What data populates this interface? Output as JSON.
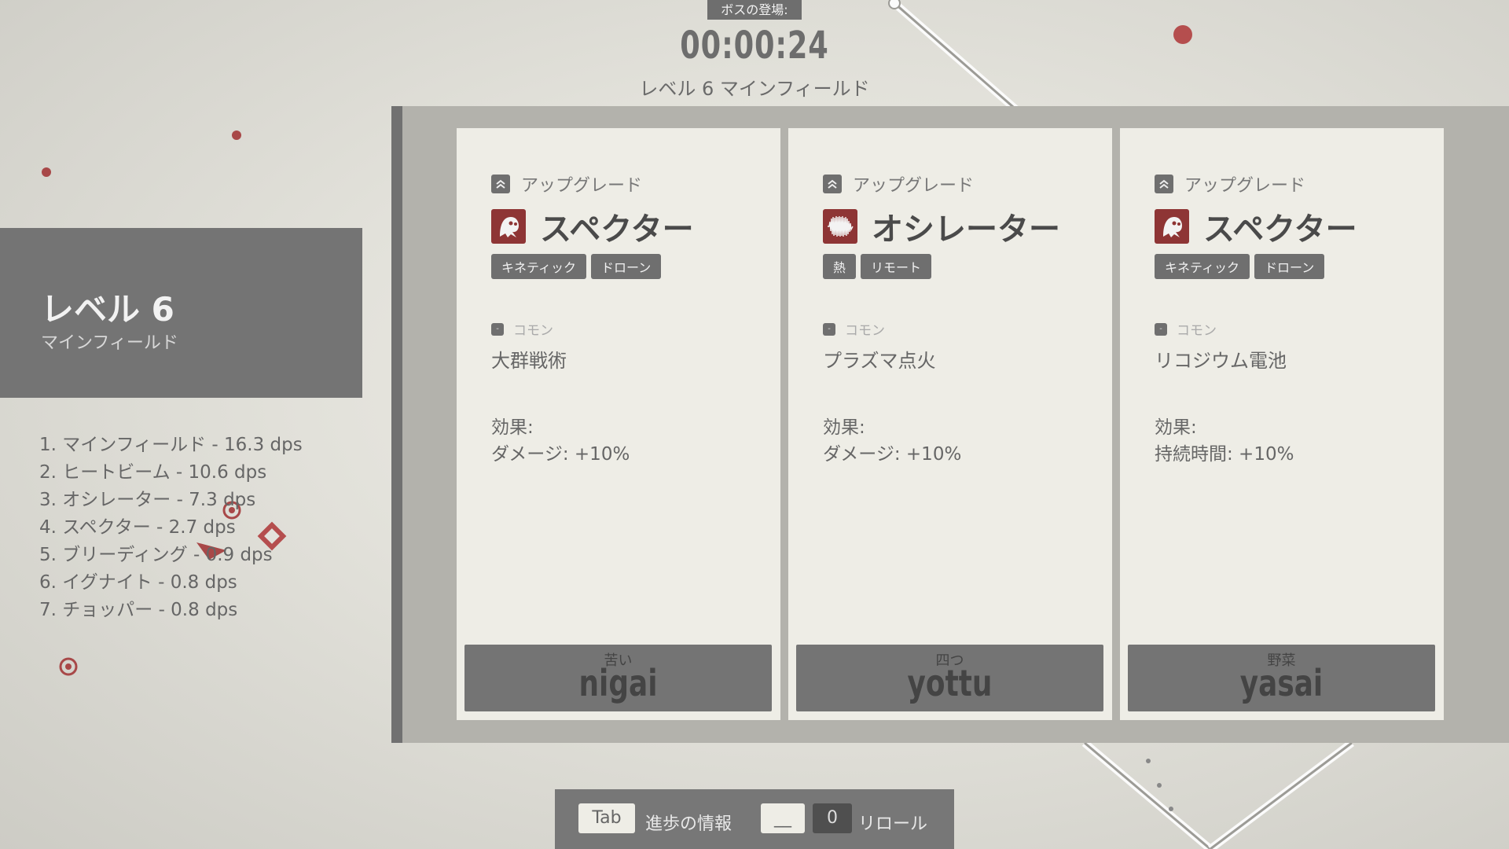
{
  "header": {
    "boss_label": "ボスの登場:",
    "timer": "00:00:24",
    "subtitle": "レベル 6 マインフィールド"
  },
  "level_panel": {
    "title": "レベル 6",
    "name": "マインフィールド"
  },
  "dps_list": [
    "1. マインフィールド - 16.3 dps",
    "2. ヒートビーム - 10.6 dps",
    "3. オシレーター - 7.3 dps",
    "4. スペクター - 2.7 dps",
    "5. ブリーディング - 0.9 dps",
    "6. イグナイト - 0.8 dps",
    "7. チョッパー - 0.8 dps"
  ],
  "cards": [
    {
      "upgrade_label": "アップグレード",
      "weapon_name": "スペクター",
      "weapon_icon": "ghost-icon",
      "tags": [
        "キネティック",
        "ドローン"
      ],
      "rarity": "コモン",
      "mod_name": "大群戦術",
      "effect_label": "効果:",
      "effect_value": "ダメージ: +10%",
      "type_kana": "苦い",
      "type_romaji": "nigai"
    },
    {
      "upgrade_label": "アップグレード",
      "weapon_name": "オシレーター",
      "weapon_icon": "waveform-icon",
      "tags": [
        "熱",
        "リモート"
      ],
      "rarity": "コモン",
      "mod_name": "プラズマ点火",
      "effect_label": "効果:",
      "effect_value": "ダメージ: +10%",
      "type_kana": "四つ",
      "type_romaji": "yottu"
    },
    {
      "upgrade_label": "アップグレード",
      "weapon_name": "スペクター",
      "weapon_icon": "ghost-icon",
      "tags": [
        "キネティック",
        "ドローン"
      ],
      "rarity": "コモン",
      "mod_name": "リコジウム電池",
      "effect_label": "効果:",
      "effect_value": "持続時間: +10%",
      "type_kana": "野菜",
      "type_romaji": "yasai"
    }
  ],
  "bottom_bar": {
    "tab_key": "Tab",
    "tab_label": "進歩の情報",
    "space_key": "__",
    "reroll_key": "0",
    "reroll_label": "リロール"
  },
  "colors": {
    "accent_red": "#8e3535",
    "panel_gray": "#747474",
    "card_bg": "#eeede6"
  }
}
